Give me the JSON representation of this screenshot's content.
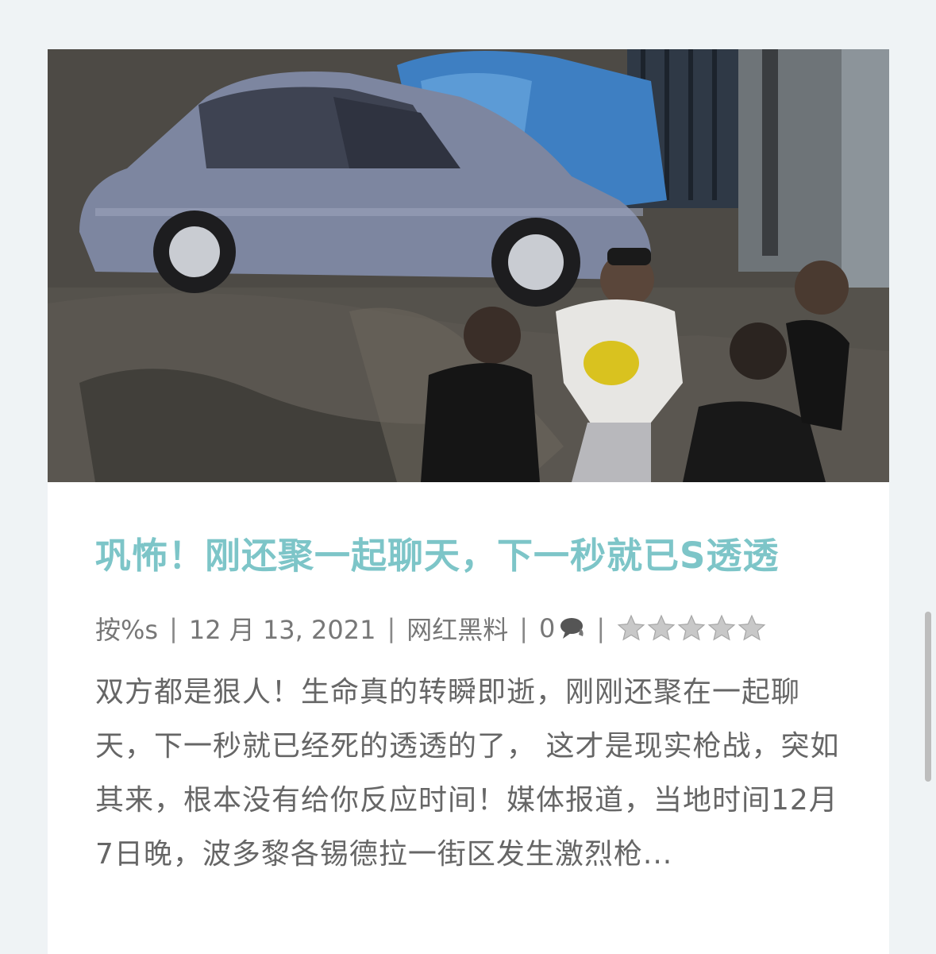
{
  "post": {
    "thumbnail": {
      "alt": "",
      "description_icon": "photo-thumbnail"
    },
    "title": "巩怖！刚还聚一起聊天，下一秒就已S透透",
    "meta": {
      "author": "按%s",
      "separator": "|",
      "date": "12 月 13, 2021",
      "category": "网红黑料",
      "comment_count": "0",
      "comment_icon": "comment-bubble-icon",
      "rating": {
        "value": 0,
        "max": 5,
        "icon": "star-icon"
      }
    },
    "excerpt": "双方都是狠人！生命真的转瞬即逝，刚刚还聚在一起聊天，下一秒就已经死的透透的了， 这才是现实枪战，突如其来，根本没有给你反应时间！媒体报道，当地时间12月7日晚，波多黎各锡德拉一街区发生激烈枪..."
  },
  "colors": {
    "page_background": "#eff3f5",
    "card_background": "#ffffff",
    "title_color": "#7dc5c8",
    "meta_color": "#777777",
    "excerpt_color": "#666666",
    "star_fill": "#c8c8c8"
  }
}
